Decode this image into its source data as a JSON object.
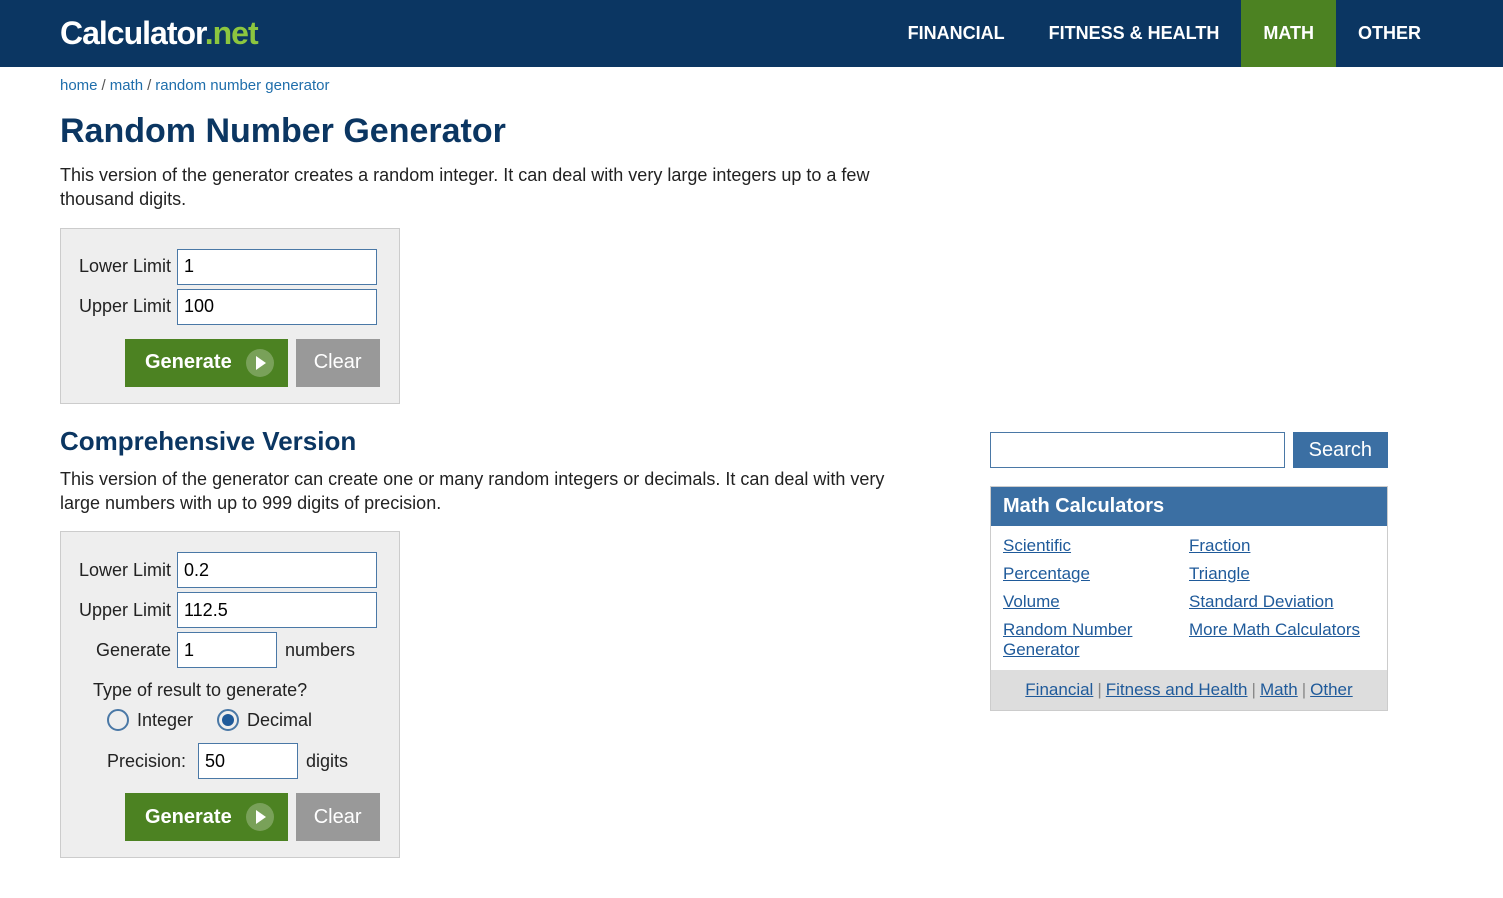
{
  "brand": {
    "name": "Calculator",
    "dot": ".",
    "ext": "net"
  },
  "nav": {
    "items": [
      "FINANCIAL",
      "FITNESS & HEALTH",
      "MATH",
      "OTHER"
    ],
    "active": 2
  },
  "breadcrumb": [
    "home",
    "math",
    "random number generator"
  ],
  "page": {
    "title": "Random Number Generator",
    "intro": "This version of the generator creates a random integer. It can deal with very large integers up to a few thousand digits."
  },
  "simple": {
    "lower_label": "Lower Limit",
    "upper_label": "Upper Limit",
    "lower": "1",
    "upper": "100",
    "generate_label": "Generate",
    "clear_label": "Clear"
  },
  "comp": {
    "heading": "Comprehensive Version",
    "intro": "This version of the generator can create one or many random integers or decimals. It can deal with very large numbers with up to 999 digits of precision.",
    "lower_label": "Lower Limit",
    "upper_label": "Upper Limit",
    "generate_row_label": "Generate",
    "numbers_suffix": "numbers",
    "lower": "0.2",
    "upper": "112.5",
    "count": "1",
    "question": "Type of result to generate?",
    "opt_integer": "Integer",
    "opt_decimal": "Decimal",
    "selected": "decimal",
    "precision_label": "Precision:",
    "precision": "50",
    "precision_suffix": "digits",
    "generate_label": "Generate",
    "clear_label": "Clear"
  },
  "search": {
    "value": "",
    "button": "Search"
  },
  "sidebox": {
    "title": "Math Calculators",
    "col1": [
      "Scientific",
      "Percentage",
      "Volume",
      "Random Number Generator"
    ],
    "col2": [
      "Fraction",
      "Triangle",
      "Standard Deviation",
      "More Math Calculators"
    ],
    "footer": [
      "Financial",
      "Fitness and Health",
      "Math",
      "Other"
    ]
  }
}
